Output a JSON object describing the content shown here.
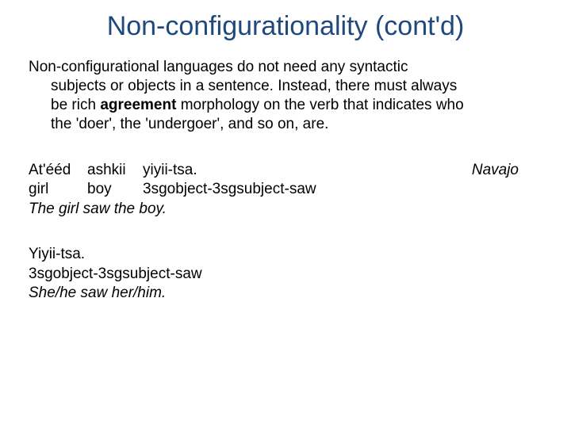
{
  "title": "Non-configurationality (cont'd)",
  "intro": {
    "l1a": "Non-configurational languages do not need any syntactic",
    "l2": "subjects or objects in a sentence. Instead, there must always",
    "l3_pre": "be rich ",
    "l3_bold": "agreement",
    "l3_post": " morphology on the verb that indicates who",
    "l4": "the 'doer', the 'undergoer', and so on, are."
  },
  "ex1": {
    "src_w1": "At'ééd",
    "src_w2": "ashkii",
    "src_w3": "yiyii-tsa.",
    "gl_w1": "girl",
    "gl_w2": "boy",
    "gl_w3": "3sgobject-3sgsubject-saw",
    "free": "The girl saw the boy.",
    "lang": "Navajo"
  },
  "ex2": {
    "src": "Yiyii-tsa.",
    "gl": "3sgobject-3sgsubject-saw",
    "free": "She/he saw her/him."
  }
}
